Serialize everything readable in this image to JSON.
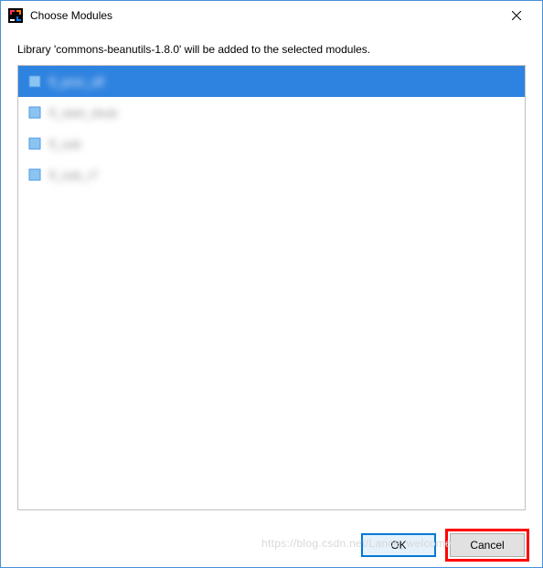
{
  "titlebar": {
    "title": "Choose Modules"
  },
  "instruction": "Library 'commons-beanutils-1.8.0' will be added to the selected modules.",
  "modules": {
    "items": [
      {
        "label": "fl_proc_slf",
        "selected": true
      },
      {
        "label": "fl_start_dsub",
        "selected": false
      },
      {
        "label": "fl_sub",
        "selected": false
      },
      {
        "label": "fl_sub_r7",
        "selected": false
      }
    ]
  },
  "buttons": {
    "ok": "OK",
    "cancel": "Cancel"
  },
  "watermark": "https://blog.csdn.net/Lance_welcome"
}
